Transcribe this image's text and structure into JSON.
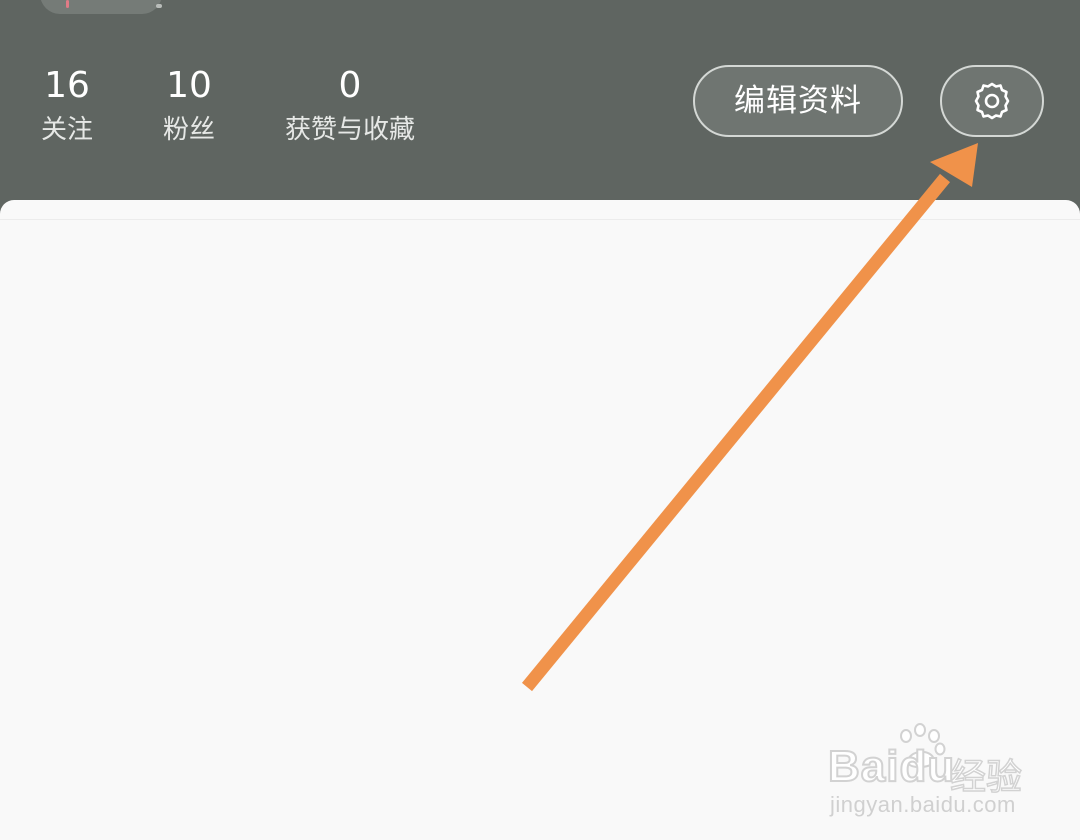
{
  "profile": {
    "stats": [
      {
        "value": "16",
        "label": "关注"
      },
      {
        "value": "10",
        "label": "粉丝"
      },
      {
        "value": "0",
        "label": "获赞与收藏"
      }
    ],
    "edit_profile_label": "编辑资料",
    "settings_icon": "gear-icon"
  },
  "watermark": {
    "brand": "Baidu",
    "suffix": "经验",
    "url": "jingyan.baidu.com"
  },
  "colors": {
    "header_bg": "#5f6561",
    "card_bg": "#f9f9f9",
    "arrow": "#f0924a"
  }
}
